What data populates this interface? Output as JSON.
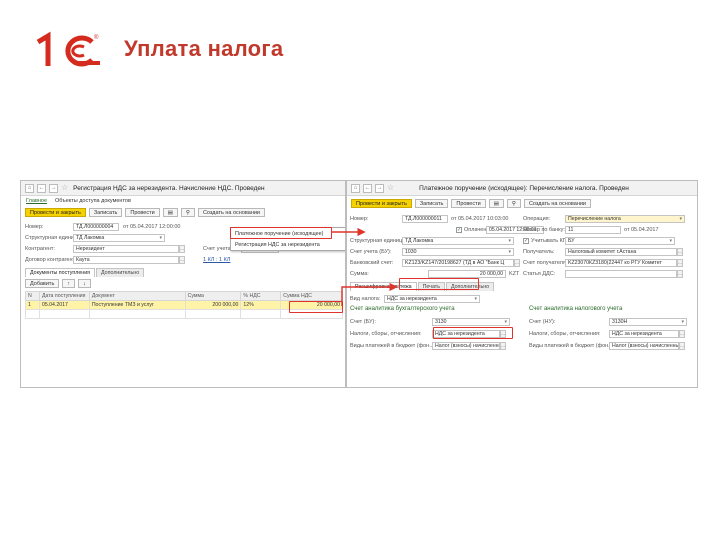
{
  "slide": {
    "title": "Уплата налога",
    "logo_text": "1С",
    "colors": {
      "title": "#c0392b",
      "logo": "#d52b1e",
      "accent": "#f5d100",
      "highlight": "#e0332b"
    }
  },
  "left_window": {
    "title": "Регистрация НДС за нерезидента. Начисление НДС. Проведен",
    "nav": [
      "Главное",
      "Объекты доступа документов"
    ],
    "toolbar": {
      "post_close": "Провести и закрыть",
      "save": "Записать",
      "post": "Провести",
      "create_based": "Создать на основании"
    },
    "number_label": "Номер:",
    "number_value": "ТД.Л000000004",
    "date_value": "от 05.04.2017 12:00:00",
    "subdivision_label": "Структурная единица:",
    "subdivision_value": "ТД Лакомка",
    "counterparty_label": "Контрагент:",
    "counterparty_value": "Нерезидент",
    "account_label": "Счет учета НДС:",
    "account_value": "3131",
    "contract_label": "Договор контрагента:",
    "contract_value": "Каута",
    "link_value": "1 КЛ : 1 КЛ",
    "tabs": [
      "Документы поступления",
      "Дополнительно"
    ],
    "add_button": "Добавить",
    "table": {
      "columns": [
        "N",
        "Дата поступления",
        "Документ",
        "Сумма",
        "% НДС",
        "Сумма НДС"
      ],
      "rows": [
        {
          "n": "1",
          "date": "05.04.2017",
          "doc": "Поступление ТМЗ и услуг",
          "sum": "200 000,00",
          "vat": "12%",
          "vat_sum": "20 000,00"
        }
      ]
    },
    "popup": {
      "item1": "Платежное поручение (исходящее)",
      "item2": "Регистрация НДС за нерезидента"
    }
  },
  "right_window": {
    "title": "Платежное поручение (исходящее): Перечисление налога. Проведен",
    "toolbar": {
      "post_close": "Провести и закрыть",
      "save": "Записать",
      "post": "Провести",
      "create_based": "Создать на основании"
    },
    "number_label": "Номер:",
    "number_value": "ТД.Л000000011",
    "date_value": "от 05.04.2017 10:03:00",
    "operation_label": "Операция:",
    "operation_value": "Перечисление налога",
    "paid_label": "Оплачено:",
    "paid_value": "05.04.2017 12:00:01",
    "bank_number_label": "Номер по банку:",
    "bank_number_value": "11",
    "bank_date": "от 05.04.2017",
    "subdivision_label": "Структурная единица:",
    "subdivision_value": "ТД Лакомка",
    "account_label": "Счет учета (БУ):",
    "account_value": "1030",
    "kbe_label": "Учитывать КПН",
    "kbe_value": "БУ",
    "bank_account_label": "Банковский счет:",
    "bank_account_value": "KZ123/KZ147/20198627 (ТД в АО \"Банк Ц",
    "recipient_label": "Получатель:",
    "recipient_value": "Налоговый комитет г.Астана",
    "recipient_account_label": "Счет получателя:",
    "recipient_account_value": "KZ23070КZ3180(22447 ко РГУ Комитет",
    "sum_label": "Сумма:",
    "sum_value": "20 000,00",
    "currency": "KZT",
    "dds_label": "Статья ДДС:",
    "dds_value": "",
    "tabs": [
      "Расшифровка платежа",
      "Печать",
      "Дополнительно"
    ],
    "vid_label": "Вид налога:",
    "vid_value": "НДС за нерезидента",
    "bu_section": "Счет аналитика бухгалтерского учета",
    "nu_section": "Счет аналитика налогового учета",
    "bu_account_label": "Счет (БУ):",
    "bu_account_value": "3130",
    "nu_account_label": "Счет (НУ):",
    "nu_account_value": "3130Н",
    "tax_label": "Налоги, сборы, отчисления:",
    "tax_value": "НДС за нерезидента",
    "tax_value_nu": "НДС за нерезидента",
    "payment_type_label": "Виды платежей в бюджет (фон...",
    "payment_type_value": "Налог (взносы) начисленные",
    "payment_type_value_nu": "Налог (взносы) начисленные"
  }
}
